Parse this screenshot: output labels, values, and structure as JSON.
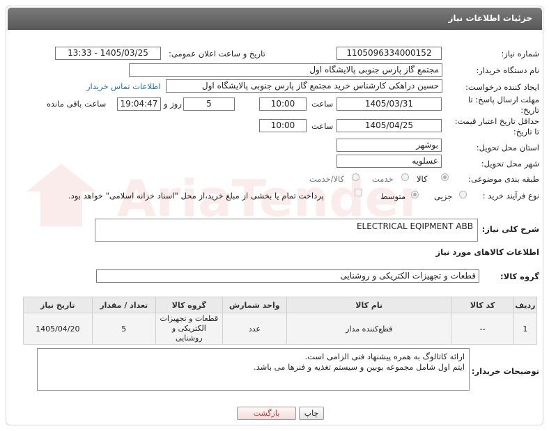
{
  "header": {
    "title": "جزئیات اطلاعات نیاز"
  },
  "fields": {
    "need_number_label": "شماره نیاز:",
    "need_number": "1105096334000152",
    "announce_label": "تاریخ و ساعت اعلان عمومی:",
    "announce_value": "1405/03/25 - 13:33",
    "buyer_org_label": "نام دستگاه خریدار:",
    "buyer_org": "مجتمع گاز پارس جنوبی  پالایشگاه اول",
    "requester_label": "ایجاد کننده درخواست:",
    "requester": "حسین دراهکی کارشناس خرید مجتمع گاز پارس جنوبی  پالایشگاه اول",
    "contact_link": "اطلاعات تماس خریدار",
    "deadline_label_1": "مهلت ارسال پاسخ: تا",
    "deadline_label_2": "تاریخ:",
    "deadline_date": "1405/03/31",
    "time_label": "ساعت",
    "deadline_time": "10:00",
    "days_value": "5",
    "days_label": "روز و",
    "remaining_time": "19:04:47",
    "remaining_label": "ساعت باقی مانده",
    "price_label_1": "حداقل تاریخ اعتبار قیمت:",
    "price_label_2": "تا تاریخ:",
    "price_date": "1405/04/25",
    "price_time": "10:00",
    "province_label": "استان محل تحویل:",
    "province": "بوشهر",
    "city_label": "شهر محل تحویل:",
    "city": "عسلویه",
    "category_label": "طبقه بندی موضوعی:",
    "category_options": [
      "کالا",
      "خدمت",
      "کالا/خدمت"
    ],
    "purchase_type_label": "نوع فرآیند خرید :",
    "purchase_options": [
      "جزیی",
      "متوسط"
    ],
    "treasury_text": "پرداخت تمام یا بخشی از مبلغ خرید،از محل \"اسناد خزانه اسلامی\" خواهد بود.",
    "description_label": "شرح کلی نیاز:",
    "description": "ELECTRICAL EQIPMENT ABB",
    "goods_info_title": "اطلاعات کالاهای مورد نیاز",
    "goods_group_label": "گروه کالا:",
    "goods_group": "قطعات و تجهیزات الکتریکی و روشنایی",
    "buyer_notes_label": "توضیحات خریدار:",
    "buyer_notes_line1": "ارائه کاتالوگ به همره پیشنهاد فنی الزامی است.",
    "buyer_notes_line2": "ایتم اول شامل مجموعه بوبین و سیستم تغذیه و فنرها می باشد."
  },
  "table": {
    "headers": [
      "ردیف",
      "کد کالا",
      "نام کالا",
      "واحد شمارش",
      "گروه کالا",
      "تعداد / مقدار",
      "تاریخ نیاز"
    ],
    "row": {
      "index": "1",
      "code": "--",
      "name": "قطع‌کننده مدار",
      "unit": "عدد",
      "group_l1": "قطعات و تجهیزات",
      "group_l2": "الکتریکی و",
      "group_l3": "روشنایی",
      "qty": "5",
      "date": "1405/04/20"
    }
  },
  "buttons": {
    "print": "چاپ",
    "back": "بازگشت"
  },
  "watermark": {
    "text": "AriaTender.neT"
  },
  "colors": {
    "header": "#666666",
    "link": "#1a6fc4",
    "back_btn": "#c0392b"
  }
}
